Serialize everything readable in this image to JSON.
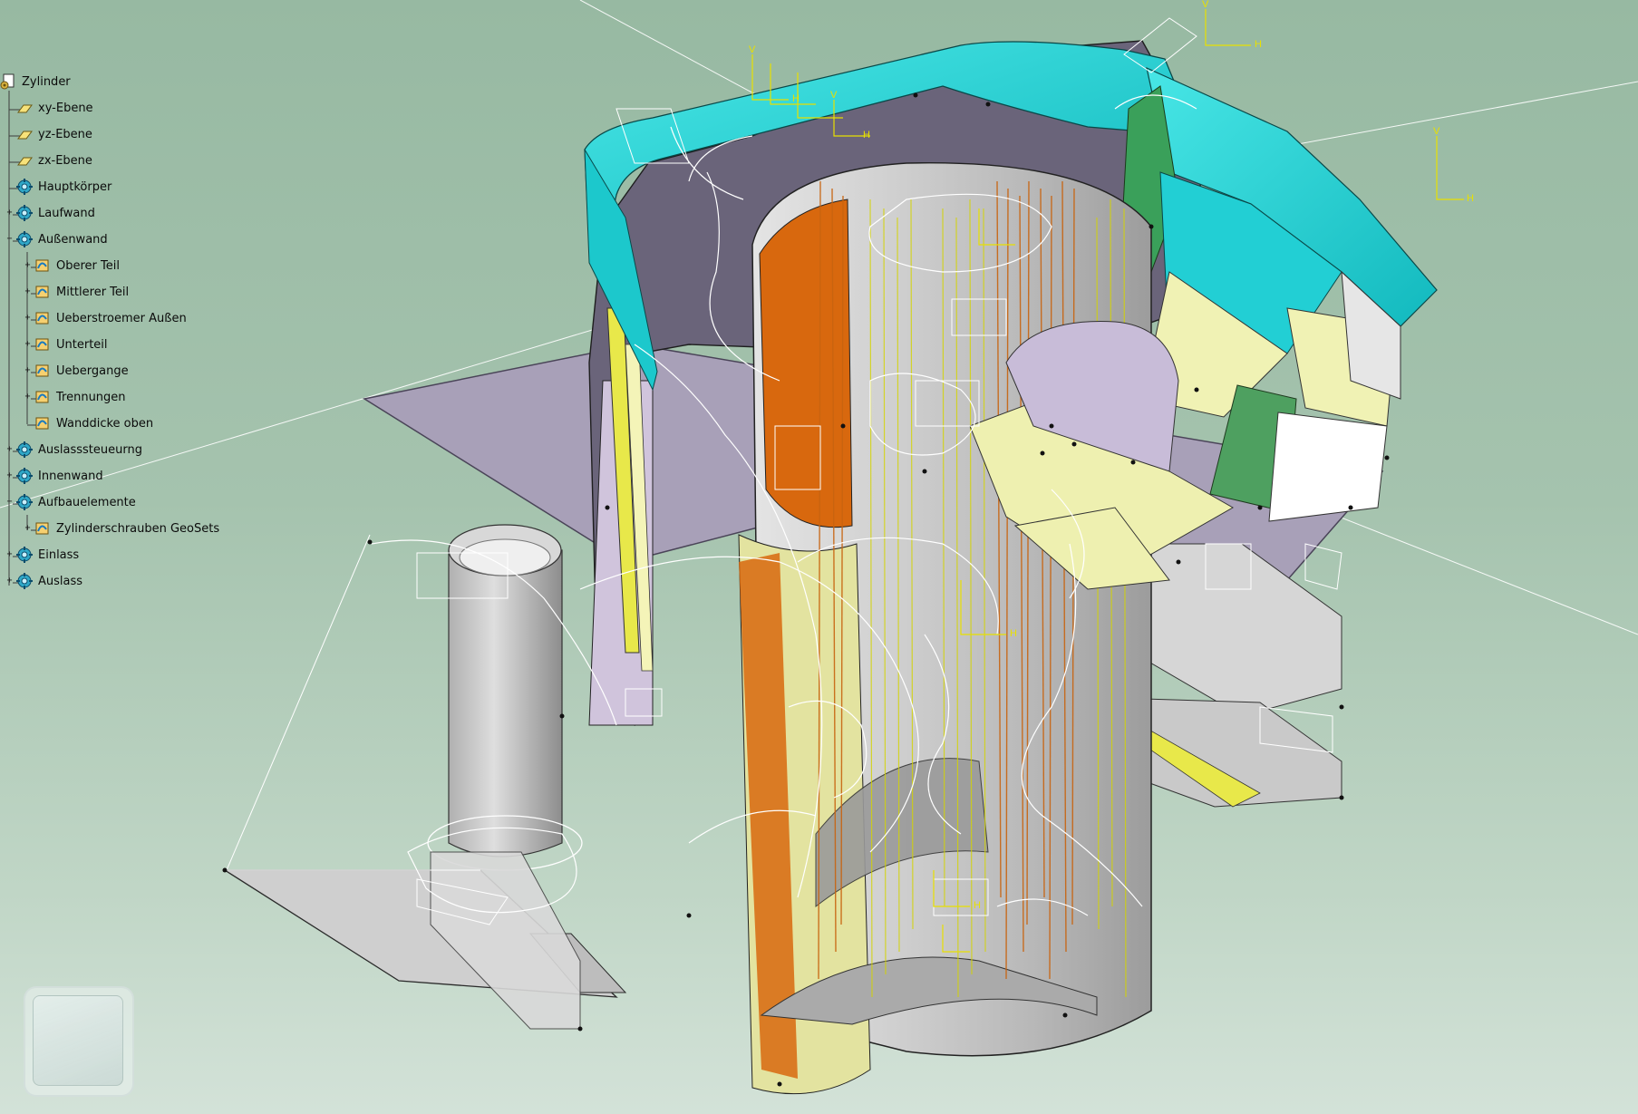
{
  "spec_tree": {
    "root": {
      "label": "Zylinder",
      "icon": "part-document-icon"
    },
    "nodes": [
      {
        "label": "xy-Ebene",
        "icon": "plane-icon",
        "expander": ""
      },
      {
        "label": "yz-Ebene",
        "icon": "plane-icon",
        "expander": ""
      },
      {
        "label": "zx-Ebene",
        "icon": "plane-icon",
        "expander": ""
      },
      {
        "label": "Hauptkörper",
        "icon": "body-gear-icon",
        "expander": ""
      },
      {
        "label": "Laufwand",
        "icon": "body-gear-icon",
        "expander": "+"
      },
      {
        "label": "Außenwand",
        "icon": "body-gear-icon",
        "expander": "−"
      },
      {
        "label": "Oberer Teil",
        "icon": "geometrical-set-icon",
        "expander": "+"
      },
      {
        "label": "Mittlerer Teil",
        "icon": "geometrical-set-icon",
        "expander": "+"
      },
      {
        "label": "Ueberstroemer Außen",
        "icon": "geometrical-set-icon",
        "expander": "+"
      },
      {
        "label": "Unterteil",
        "icon": "geometrical-set-icon",
        "expander": "+"
      },
      {
        "label": "Uebergange",
        "icon": "geometrical-set-icon",
        "expander": "+"
      },
      {
        "label": "Trennungen",
        "icon": "geometrical-set-icon",
        "expander": "+"
      },
      {
        "label": "Wanddicke oben",
        "icon": "geometrical-set-icon",
        "expander": ""
      },
      {
        "label": "Auslasssteueurng",
        "icon": "body-gear-icon",
        "expander": "+"
      },
      {
        "label": "Innenwand",
        "icon": "body-gear-icon",
        "expander": "+"
      },
      {
        "label": "Aufbauelemente",
        "icon": "body-gear-icon",
        "expander": "−"
      },
      {
        "label": "Zylinderschrauben GeoSets",
        "icon": "geometrical-set-icon",
        "expander": "+"
      },
      {
        "label": "Einlass",
        "icon": "body-gear-icon",
        "expander": "+"
      },
      {
        "label": "Auslass",
        "icon": "body-gear-icon",
        "expander": "+"
      }
    ]
  },
  "axis_markers": [
    "H",
    "V",
    "H",
    "V",
    "H",
    "V",
    "H",
    "V",
    "H",
    "H"
  ],
  "colors": {
    "background_top": "#97b9a2",
    "plane_fill": "#a8a0b8",
    "surface_gray": "#c9c9c9",
    "surface_dark_purple": "#6a647a",
    "surface_cyan": "#20d8dc",
    "surface_orange": "#d8680e",
    "surface_yellow": "#e8e84a",
    "surface_pale_yellow": "#eef0b0",
    "wire_white": "#ffffff",
    "sketch_yellow": "#e8e000"
  }
}
